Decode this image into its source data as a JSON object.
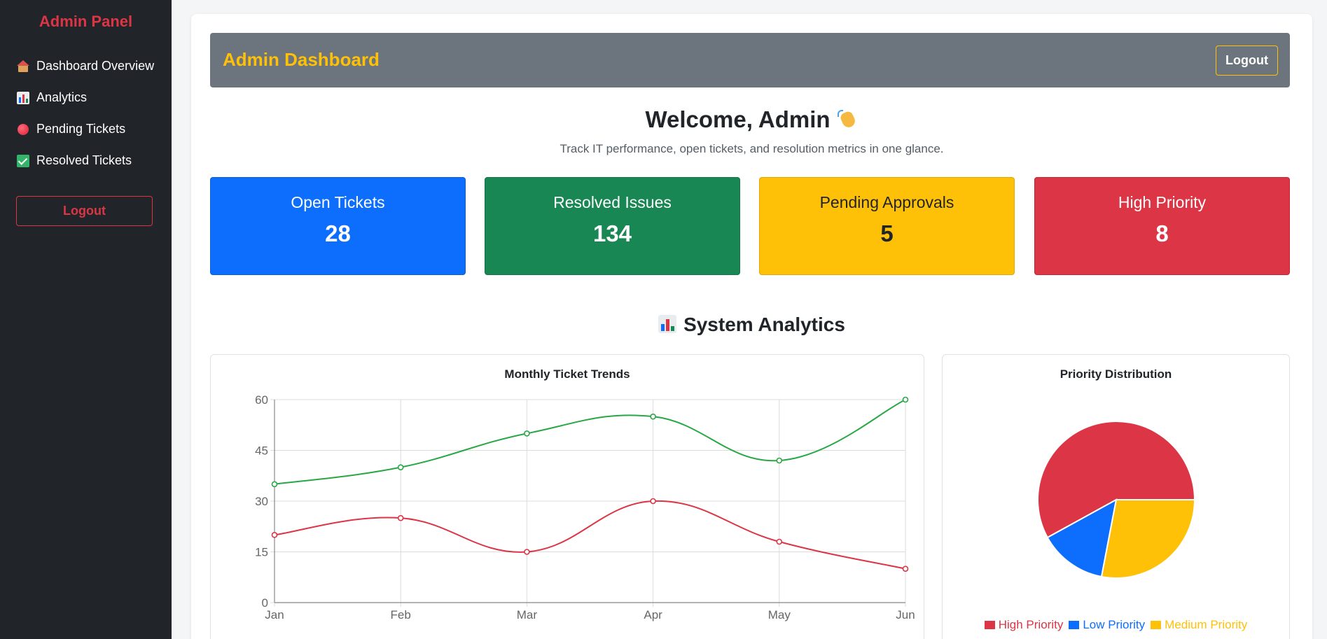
{
  "sidebar": {
    "brand": "Admin Panel",
    "items": [
      {
        "label": "Dashboard Overview",
        "icon": "house-icon"
      },
      {
        "label": "Analytics",
        "icon": "bar-chart-icon"
      },
      {
        "label": "Pending Tickets",
        "icon": "red-circle-icon"
      },
      {
        "label": "Resolved Tickets",
        "icon": "check-box-icon"
      }
    ],
    "logout_label": "Logout"
  },
  "header": {
    "title": "Admin Dashboard",
    "logout_label": "Logout"
  },
  "welcome": {
    "title": "Welcome, Admin",
    "subtitle": "Track IT performance, open tickets, and resolution metrics in one glance."
  },
  "stats": [
    {
      "label": "Open Tickets",
      "value": "28",
      "color": "#0d6efd"
    },
    {
      "label": "Resolved Issues",
      "value": "134",
      "color": "#198754"
    },
    {
      "label": "Pending Approvals",
      "value": "5",
      "color": "#ffc107"
    },
    {
      "label": "High Priority",
      "value": "8",
      "color": "#dc3545"
    }
  ],
  "analytics": {
    "title": "System Analytics"
  },
  "chart_data": [
    {
      "type": "line",
      "title": "Monthly Ticket Trends",
      "categories": [
        "Jan",
        "Feb",
        "Mar",
        "Apr",
        "May",
        "Jun"
      ],
      "series": [
        {
          "values": [
            35,
            40,
            50,
            55,
            42,
            60
          ],
          "color": "#28a745"
        },
        {
          "values": [
            20,
            25,
            15,
            30,
            18,
            10
          ],
          "color": "#dc3545"
        }
      ],
      "ylim": [
        0,
        60
      ],
      "yticks": [
        0,
        15,
        30,
        45,
        60
      ],
      "grid": true,
      "smooth": true
    },
    {
      "type": "pie",
      "title": "Priority Distribution",
      "categories": [
        "High Priority",
        "Low Priority",
        "Medium Priority"
      ],
      "values": [
        58,
        14,
        28
      ],
      "colors": [
        "#dc3545",
        "#0d6efd",
        "#ffc107"
      ],
      "legend": "bottom"
    }
  ]
}
